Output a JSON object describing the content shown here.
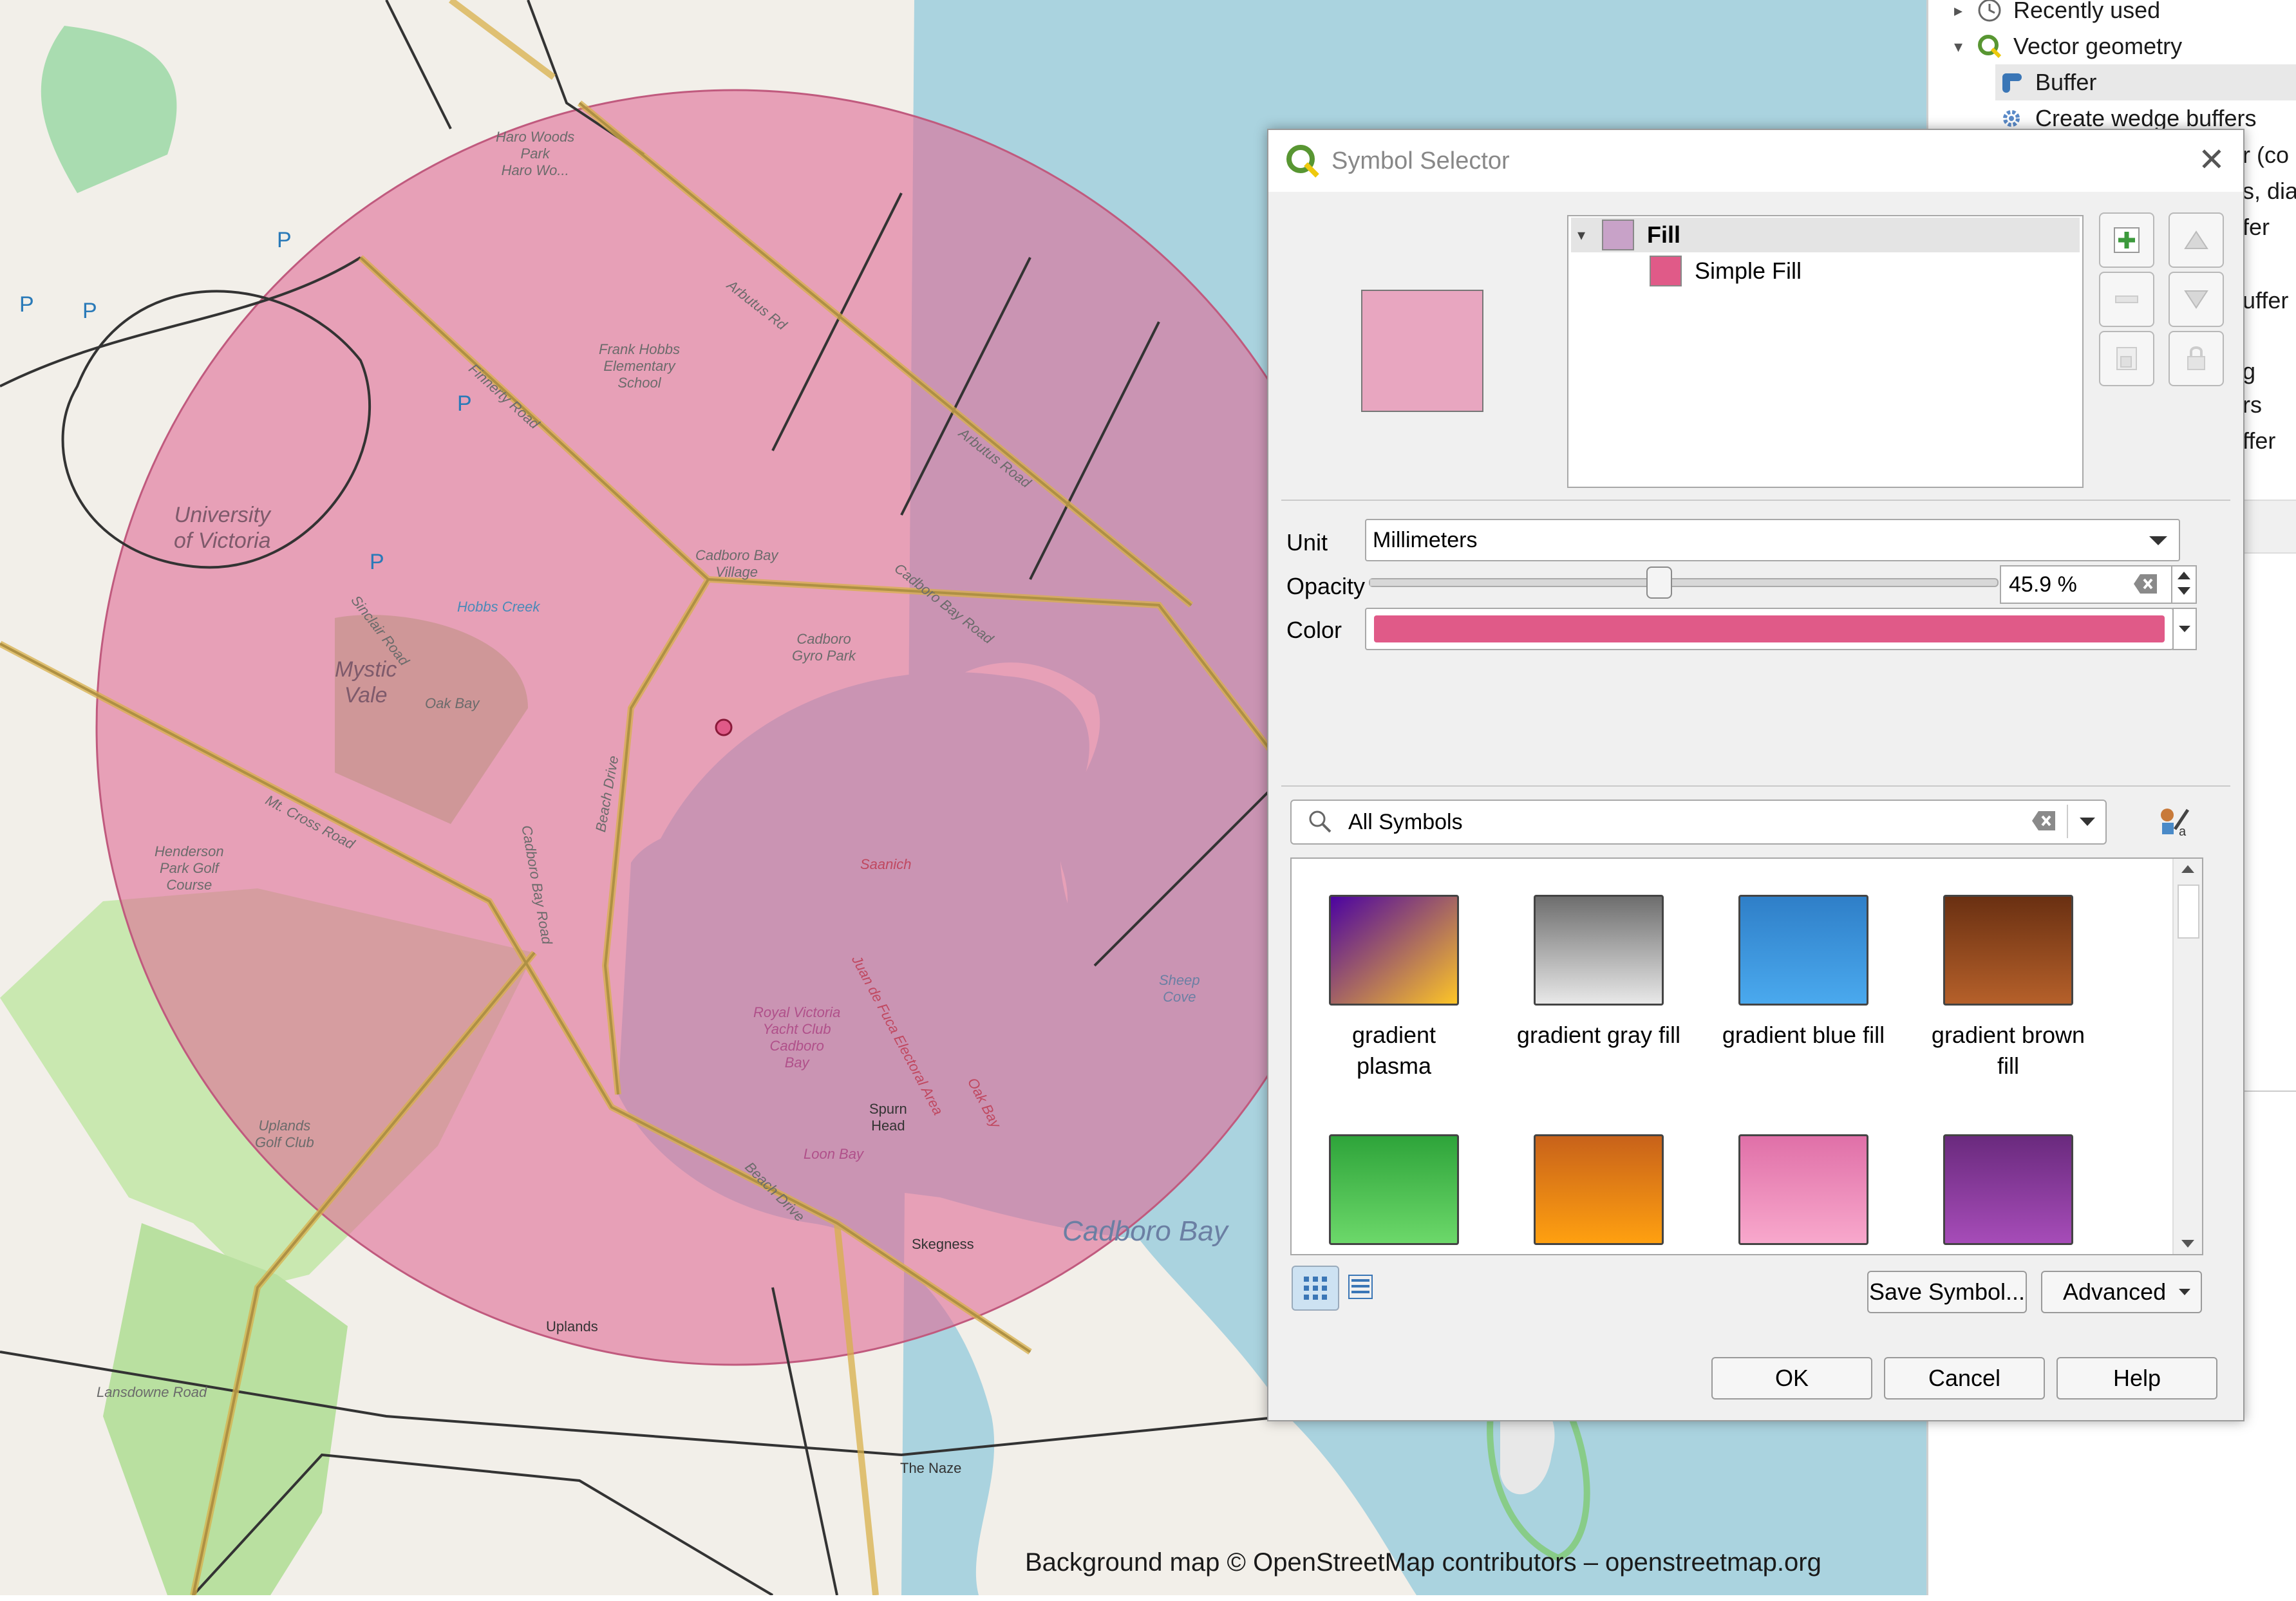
{
  "map": {
    "labels": {
      "haro_woods": "Haro Woods\nPark\nHaro Wo...",
      "frank_hobbs": "Frank Hobbs\nElementary\nSchool",
      "university": "University\nof Victoria",
      "mystic_vale": "Mystic\nVale",
      "oak_bay": "Oak Bay",
      "cadboro_bay_village": "Cadboro Bay\nVillage",
      "cadboro_gyro": "Cadboro\nGyro Park",
      "henderson": "Henderson\nPark Golf\nCourse",
      "uplands_golf": "Uplands\nGolf Club",
      "spurn_head": "Spurn\nHead",
      "skegness": "Skegness",
      "cadboro_bay_water": "Cadboro Bay",
      "the_naze": "The Naze",
      "uplands": "Uplands",
      "royal_victoria": "Royal Victoria\nYacht Club\nCadboro\nBay",
      "saanich": "Saanich",
      "juan_de_fuca": "Juan de Fuca Electoral Area",
      "oak_bay2": "Oak Bay",
      "loon_bay": "Loon Bay",
      "sheep_cove": "Sheep\nCove",
      "arbutus": "Arbutus Rd",
      "arbutus2": "Arbutus Road",
      "cadboro_bay_road": "Cadboro Bay Road",
      "finnerty": "Finnerty Road",
      "sinclair": "Sinclair Road",
      "beach_drive": "Beach Drive",
      "cadboro_bay_road2": "Cadboro Bay Road",
      "beach_drive2": "Beach Drive",
      "mt_cross": "Mt. Cross Road",
      "hobbs_creek": "Hobbs Creek",
      "lansdowne": "Lansdowne Road",
      "p": "P"
    },
    "attribution": "Background map © OpenStreetMap contributors – openstreetmap.org",
    "buffer_color": "#e06a96",
    "water_color": "#aad3df"
  },
  "toolbox": {
    "recently_used": "Recently used",
    "vector_geometry": "Vector geometry",
    "buffer": "Buffer",
    "create_wedge": "Create wedge buffers",
    "partials": [
      "r (co",
      "s, dia",
      "fer",
      "uffer",
      "g",
      "rs",
      "ffer"
    ]
  },
  "dialog": {
    "title": "Symbol Selector",
    "tree": {
      "fill": "Fill",
      "simple_fill": "Simple Fill",
      "fill_color": "#c8a2c8",
      "simple_fill_color": "#e05a88"
    },
    "unit_label": "Unit",
    "unit_value": "Millimeters",
    "opacity_label": "Opacity",
    "opacity_value": "45.9 %",
    "opacity_fraction": 0.459,
    "color_label": "Color",
    "color_value": "#e05a88",
    "preview_color": "#e8a6c0",
    "search_value": "All Symbols",
    "symbols": [
      {
        "label": "gradient\nplasma",
        "from": "#4b03a1",
        "to": "#fdc527",
        "dir": "to bottom right"
      },
      {
        "label": "gradient  gray fill",
        "from": "#6e6e6e",
        "to": "#e8e8e8",
        "dir": "to bottom"
      },
      {
        "label": "gradient blue fill",
        "from": "#2f7fc8",
        "to": "#4aa9ee",
        "dir": "to bottom"
      },
      {
        "label": "gradient brown\nfill",
        "from": "#6a3012",
        "to": "#b5602a",
        "dir": "to bottom"
      },
      {
        "label": "",
        "from": "#2ea43a",
        "to": "#6cd86a",
        "dir": "to bottom"
      },
      {
        "label": "",
        "from": "#c8621a",
        "to": "#ffa010",
        "dir": "to bottom"
      },
      {
        "label": "",
        "from": "#e070a8",
        "to": "#f8a8cc",
        "dir": "to bottom"
      },
      {
        "label": "",
        "from": "#6a2a7e",
        "to": "#a64cb8",
        "dir": "to bottom"
      }
    ],
    "save_symbol": "Save Symbol...",
    "advanced": "Advanced",
    "ok": "OK",
    "cancel": "Cancel",
    "help": "Help"
  }
}
